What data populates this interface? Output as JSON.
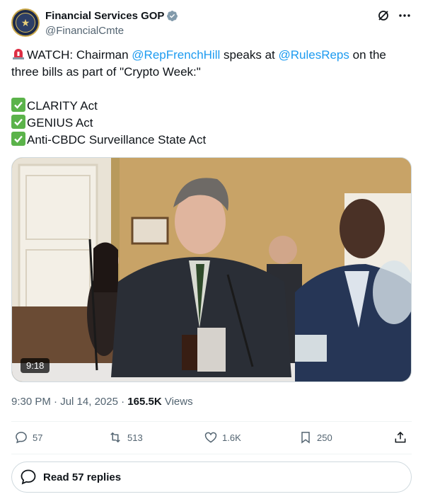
{
  "author": {
    "display_name": "Financial Services GOP",
    "handle": "@FinancialCmte",
    "verified": true
  },
  "tweet": {
    "line1_prefix": "WATCH: Chairman ",
    "mention1": "@RepFrenchHill",
    "line1_mid": " speaks at ",
    "mention2": "@RulesReps",
    "line1_suffix": " on the",
    "line2": "three bills as part of \"Crypto Week:\"",
    "bills": [
      "CLARITY Act",
      "GENIUS Act",
      "Anti-CBDC Surveillance State Act"
    ]
  },
  "media": {
    "duration": "9:18"
  },
  "meta": {
    "time": "9:30 PM",
    "sep1": " · ",
    "date": "Jul 14, 2025",
    "sep2": " · ",
    "views_count": "165.5K",
    "views_label": " Views"
  },
  "actions": {
    "replies": "57",
    "retweets": "513",
    "likes": "1.6K",
    "bookmarks": "250"
  },
  "replies_button": {
    "label": "Read 57 replies"
  },
  "colors": {
    "accent": "#1d9bf0",
    "muted": "#536471",
    "border": "#cfd9de"
  }
}
